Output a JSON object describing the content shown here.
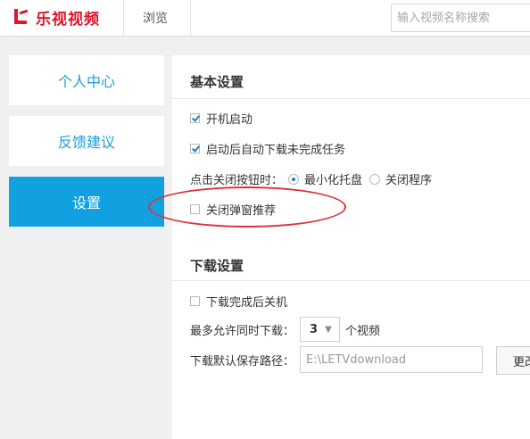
{
  "header": {
    "brand": "乐视视频",
    "nav_browse": "浏览",
    "search_placeholder": "输入视频名称搜索"
  },
  "sidebar": {
    "items": [
      {
        "label": "个人中心",
        "active": false
      },
      {
        "label": "反馈建议",
        "active": false
      },
      {
        "label": "设置",
        "active": true
      }
    ]
  },
  "basic_settings": {
    "title": "基本设置",
    "auto_start": {
      "label": "开机启动",
      "checked": true
    },
    "auto_download": {
      "label": "启动后自动下载未完成任务",
      "checked": true
    },
    "close_action": {
      "label": "点击关闭按钮时：",
      "options": [
        {
          "label": "最小化托盘",
          "selected": true
        },
        {
          "label": "关闭程序",
          "selected": false
        }
      ]
    },
    "close_popup": {
      "label": "关闭弹窗推荐",
      "checked": false
    }
  },
  "download_settings": {
    "title": "下载设置",
    "shutdown_after": {
      "label": "下载完成后关机",
      "checked": false
    },
    "max_concurrent": {
      "label": "最多允许同时下载：",
      "value": "3",
      "unit": "个视频"
    },
    "save_path": {
      "label": "下载默认保存路径：",
      "value": "E:\\LETVdownload",
      "change_button": "更改"
    }
  },
  "colors": {
    "brand_red": "#e0142c",
    "accent_blue": "#11a1e1",
    "annotation_red": "#e0303a"
  }
}
